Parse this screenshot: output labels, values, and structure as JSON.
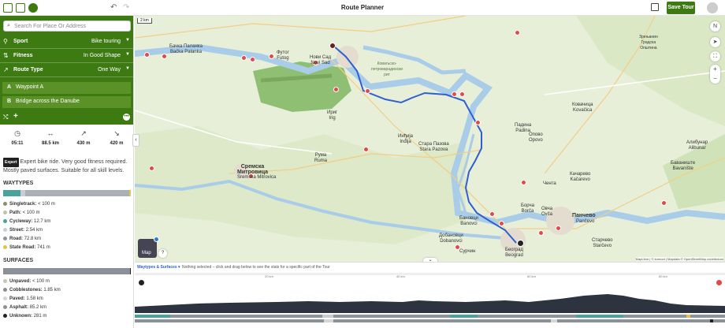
{
  "app": {
    "title": "Route Planner",
    "save_label": "Save Tour"
  },
  "search": {
    "placeholder": "Search For Place Or Address"
  },
  "settings": [
    {
      "label": "Sport",
      "value": "Bike touring"
    },
    {
      "label": "Fitness",
      "value": "In Good Shape"
    },
    {
      "label": "Route Type",
      "value": "One Way"
    }
  ],
  "waypoints": [
    {
      "letter": "A",
      "name": "Waypoint A"
    },
    {
      "letter": "B",
      "name": "Bridge across the Danube"
    }
  ],
  "stats": [
    {
      "icon": "clock-icon",
      "value": "05:11"
    },
    {
      "icon": "distance-icon",
      "value": "88.5 km"
    },
    {
      "icon": "ascent-icon",
      "value": "430 m"
    },
    {
      "icon": "descent-icon",
      "value": "420 m"
    }
  ],
  "difficulty": {
    "badge": "Expert",
    "text": "Expert bike ride. Very good fitness required. Mostly paved surfaces. Suitable for all skill levels."
  },
  "waytypes": {
    "title": "WAYTYPES",
    "items": [
      {
        "label": "Singletrack:",
        "value": "< 100 m",
        "color": "#8a8f6a"
      },
      {
        "label": "Path:",
        "value": "< 100 m",
        "color": "#bfc2a8"
      },
      {
        "label": "Cycleway:",
        "value": "12.7 km",
        "color": "#49a39a"
      },
      {
        "label": "Street:",
        "value": "2.54 km",
        "color": "#c9cdd1"
      },
      {
        "label": "Road:",
        "value": "72.8 km",
        "color": "#8d959c"
      },
      {
        "label": "State Road:",
        "value": "741 m",
        "color": "#e5c24a"
      }
    ]
  },
  "surfaces": {
    "title": "SURFACES",
    "items": [
      {
        "label": "Unpaved:",
        "value": "< 100 m",
        "color": "#c9c3b0"
      },
      {
        "label": "Cobblestones:",
        "value": "1.85 km",
        "color": "#8d8d8d"
      },
      {
        "label": "Paved:",
        "value": "1.58 km",
        "color": "#d6d6d6"
      },
      {
        "label": "Asphalt:",
        "value": "85.2 km",
        "color": "#8a9199"
      },
      {
        "label": "Unknown:",
        "value": "281 m",
        "color": "#222222"
      }
    ]
  },
  "map": {
    "scale": "2 km",
    "layer_button": "Map",
    "attribution": "MapLibre | © komoot | Mapdata © OpenStreetMap contributors",
    "labels": [
      {
        "text": "Бачка Паланка\nBačka Palanka"
      },
      {
        "text": "Футог\nFutog"
      },
      {
        "text": "Нови Сад\nNovi Sad"
      },
      {
        "text": "Ковиљско-\nпетроварадински\nрит"
      },
      {
        "text": "Ириг\nIrig"
      },
      {
        "text": "Инђија\nInđija"
      },
      {
        "text": "Стара Пазова\nStara Pazova"
      },
      {
        "text": "Рума\nRuma"
      },
      {
        "text": "Сремска\nМитровица",
        "big": true
      },
      {
        "text": "Sremska Mitrovica"
      },
      {
        "text": "Зрењанин\nГрадска\nОпштина"
      },
      {
        "text": "Ковачица\nKovačica"
      },
      {
        "text": "Падина\nPadina"
      },
      {
        "text": "Алибунар\nAlibunar"
      },
      {
        "text": "Качарево\nKačarevo"
      },
      {
        "text": "Панчево",
        "big": true
      },
      {
        "text": "Pančevo"
      },
      {
        "text": "Београд\nBeograd"
      },
      {
        "text": "Борча\nBorča"
      },
      {
        "text": "Овча\nOvča"
      },
      {
        "text": "Старчево\nStarčevo"
      },
      {
        "text": "Опово\nOpovo"
      },
      {
        "text": "Добановци\nDobanovci"
      },
      {
        "text": "Бановци\nBanovci"
      },
      {
        "text": "Сурчин"
      },
      {
        "text": "Чента"
      },
      {
        "text": "Баваниште\nBavanište"
      }
    ]
  },
  "elevation": {
    "tab_label": "Waytypes & Surfaces",
    "hint": "Nothing selected – click and drag below to see the stats for a specific part of the Tour",
    "ticks": [
      "20 km",
      "40 km",
      "60 km",
      "80 km"
    ],
    "collapse_icon": "chevron-down-icon"
  },
  "colors": {
    "brand": "#3d7a12",
    "route": "#2f5fd0",
    "poi": "#e54848",
    "river": "#a9cde8"
  }
}
